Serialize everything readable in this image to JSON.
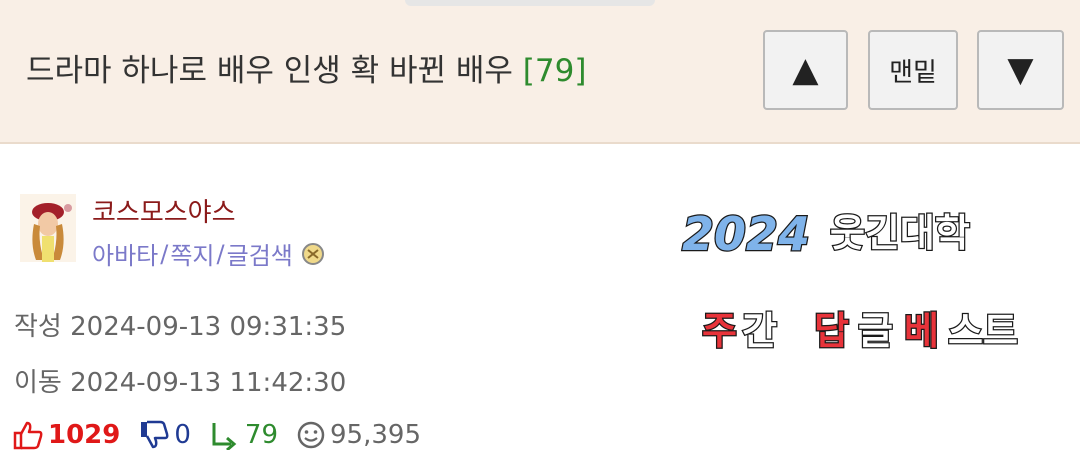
{
  "header": {
    "title": "드라마 하나로 배우 인생 확 바뀐 배우",
    "reply_count_label": "[79]",
    "btn_up": "▲",
    "btn_bottom": "맨밑",
    "btn_down": "▼"
  },
  "author": {
    "nickname": "코스모스야스",
    "links": [
      "아바타",
      "쪽지",
      "글검색"
    ],
    "link_separator": "/"
  },
  "meta": {
    "write_label": "작성",
    "write_time": "2024-09-13 09:31:35",
    "move_label": "이동",
    "move_time": "2024-09-13 11:42:30"
  },
  "stats": {
    "likes": "1029",
    "dislikes": "0",
    "replies": "79",
    "views": "95,395"
  },
  "banner": {
    "year": "2024",
    "site": "웃긴대학",
    "w1": "주",
    "w2": "간",
    "w3": "답",
    "w4": "글",
    "w5": "베",
    "w6": "스트"
  },
  "colors": {
    "header_bg": "#f9efe6",
    "nickname": "#8b1a1a",
    "links": "#7b79c9",
    "likes": "#e01818",
    "dislikes": "#1f3a93",
    "replies": "#2e8b2e",
    "banner_year": "#7fb3ea",
    "banner_highlight": "#e8333a"
  }
}
